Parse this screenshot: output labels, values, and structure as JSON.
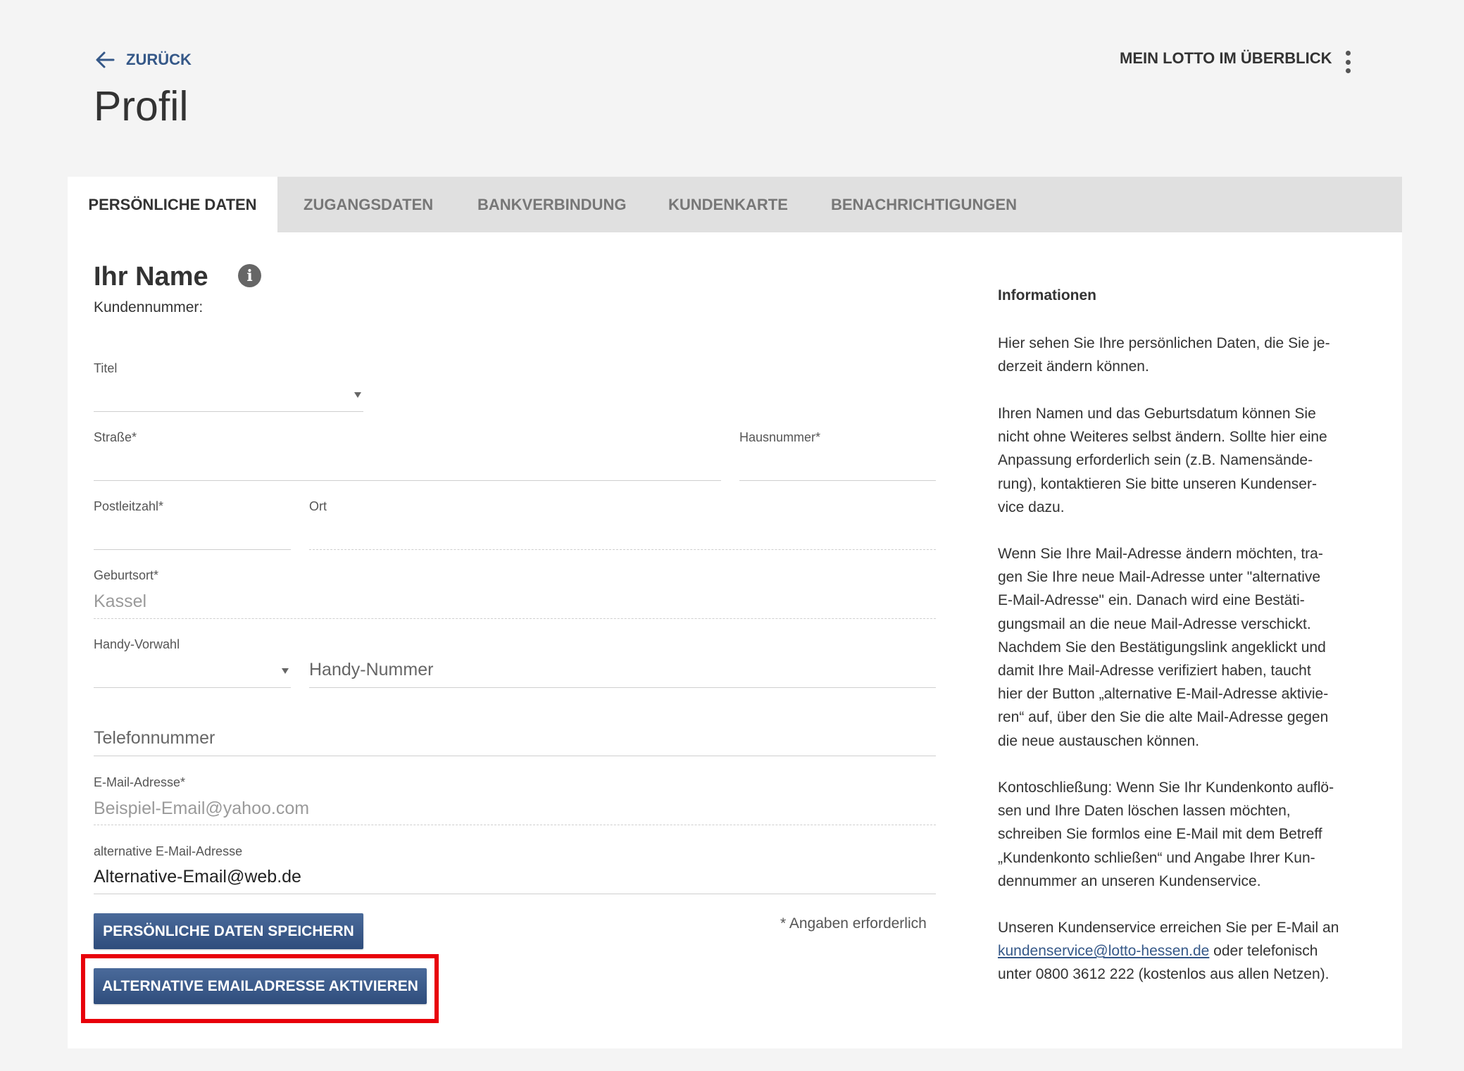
{
  "header": {
    "back_label": "ZURÜCK",
    "title": "Profil",
    "overview_label": "MEIN LOTTO IM ÜBERBLICK"
  },
  "tabs": [
    {
      "label": "PERSÖNLICHE DATEN",
      "active": true
    },
    {
      "label": "ZUGANGSDATEN",
      "active": false
    },
    {
      "label": "BANKVERBINDUNG",
      "active": false
    },
    {
      "label": "KUNDENKARTE",
      "active": false
    },
    {
      "label": "BENACHRICHTIGUNGEN",
      "active": false
    }
  ],
  "form": {
    "heading": "Ihr Name",
    "customer_number_label": "Kundennummer:",
    "titel": {
      "label": "Titel",
      "value": ""
    },
    "strasse": {
      "label": "Straße*",
      "value": ""
    },
    "hausnummer": {
      "label": "Hausnummer*",
      "value": ""
    },
    "plz": {
      "label": "Postleitzahl*",
      "value": ""
    },
    "ort": {
      "label": "Ort",
      "value": ""
    },
    "geburtsort": {
      "label": "Geburtsort*",
      "value": "Kassel"
    },
    "handy_vorwahl": {
      "label": "Handy-Vorwahl",
      "value": ""
    },
    "handy_nummer": {
      "placeholder": "Handy-Nummer"
    },
    "telefon": {
      "placeholder": "Telefonnummer"
    },
    "email": {
      "label": "E-Mail-Adresse*",
      "value": "Beispiel-Email@yahoo.com"
    },
    "alt_email": {
      "label": "alternative E-Mail-Adresse",
      "value": "Alternative-Email@web.de"
    },
    "required_note": "* Angaben erforderlich",
    "save_button": "PERSÖNLICHE DATEN SPEICHERN",
    "activate_button": "ALTERNATIVE EMAILADRESSE AKTIVIEREN"
  },
  "info": {
    "title": "Informationen",
    "p1": "Hier sehen Sie Ihre persönlichen Daten, die Sie je-\nderzeit ändern können.",
    "p2": "Ihren Namen und das Geburtsdatum können Sie\nnicht ohne Weiteres selbst ändern. Sollte hier eine\nAnpassung erforderlich sein (z.B. Namensände-\nrung), kontaktieren Sie bitte unseren Kundenser-\nvice dazu.",
    "p3": "Wenn Sie Ihre Mail-Adresse ändern möchten, tra-\ngen Sie Ihre neue Mail-Adresse unter \"alternative\nE-Mail-Adresse\" ein. Danach wird eine Bestäti-\ngungsmail an die neue Mail-Adresse verschickt.\nNachdem Sie den Bestätigungslink angeklickt und\ndamit Ihre Mail-Adresse verifiziert haben, taucht\nhier der Button „alternative E-Mail-Adresse aktivie-\nren“ auf, über den Sie die alte Mail-Adresse gegen\ndie neue austauschen können.",
    "p4": "Kontoschließung: Wenn Sie Ihr Kundenkonto auflö-\nsen und Ihre Daten löschen lassen möchten,\nschreiben Sie formlos eine E-Mail mit dem Betreff\n„Kundenkonto schließen“ und Angabe Ihrer Kun-\ndennummer an unseren Kundenservice.",
    "p5_before": "Unseren Kundenservice erreichen Sie per E-Mail an",
    "p5_link": "kundenservice@lotto-hessen.de",
    "p5_after_link": " oder telefonisch",
    "p5_end": "unter 0800 3612 222 (kostenlos aus allen Netzen)."
  },
  "colors": {
    "accent": "#355888",
    "button": "#3b5a8a",
    "highlight": "#e8000a",
    "background": "#f4f4f4"
  }
}
